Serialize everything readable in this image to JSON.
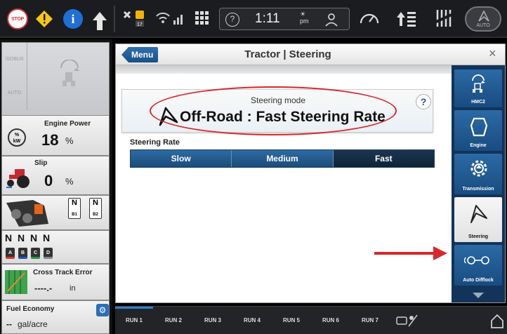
{
  "statusbar": {
    "stop_label": "STOP",
    "time": "1:11",
    "ampm": "pm",
    "auto_label": "AUTO"
  },
  "left": {
    "isobus_label": "ISOBUS",
    "auto_label": "AUTO",
    "engine_power": {
      "label": "Engine Power",
      "value": "18",
      "unit": "%",
      "icon_text": "%\nkW"
    },
    "slip": {
      "label": "Slip",
      "value": "0",
      "unit": "%"
    },
    "brakes": {
      "b1_n": "N",
      "b1": "B1",
      "b2_n": "N",
      "b2": "B2",
      "tag_b1": "B1",
      "tag_b2": "B2",
      "tag_a": "A"
    },
    "remotes": [
      {
        "n": "N",
        "tag": "A",
        "color": "#d63b2c"
      },
      {
        "n": "N",
        "tag": "B",
        "color": "#2a4fb8"
      },
      {
        "n": "N",
        "tag": "C",
        "color": "#29964a"
      },
      {
        "n": "N",
        "tag": "D",
        "color": "#333333"
      }
    ],
    "cross_track": {
      "label": "Cross Track Error",
      "value": "----.-",
      "unit": "in"
    },
    "fuel": {
      "label": "Fuel Economy",
      "value": "--",
      "unit": "gal/acre"
    }
  },
  "window": {
    "menu_label": "Menu",
    "title": "Tractor | Steering",
    "close_icon": "×"
  },
  "steering": {
    "mode_label": "Steering mode",
    "mode_value": "Off-Road : Fast Steering Rate",
    "help": "?",
    "rate_label": "Steering Rate",
    "rate_options": [
      "Slow",
      "Medium",
      "Fast"
    ],
    "rate_selected": "Fast"
  },
  "nav": [
    {
      "label": "HMC2",
      "icon": "hmc2-icon"
    },
    {
      "label": "Engine",
      "icon": "engine-icon"
    },
    {
      "label": "Transmission",
      "icon": "transmission-icon"
    },
    {
      "label": "Steering",
      "icon": "steering-icon"
    },
    {
      "label": "Auto Difflock",
      "icon": "difflock-icon"
    }
  ],
  "runs": [
    "RUN 1",
    "RUN 2",
    "RUN 3",
    "RUN 4",
    "RUN 5",
    "RUN 6",
    "RUN 7"
  ],
  "colors": {
    "accent": "#1b4c7a",
    "annotation_red": "#d8262b",
    "nav_bg": "#12335a"
  }
}
